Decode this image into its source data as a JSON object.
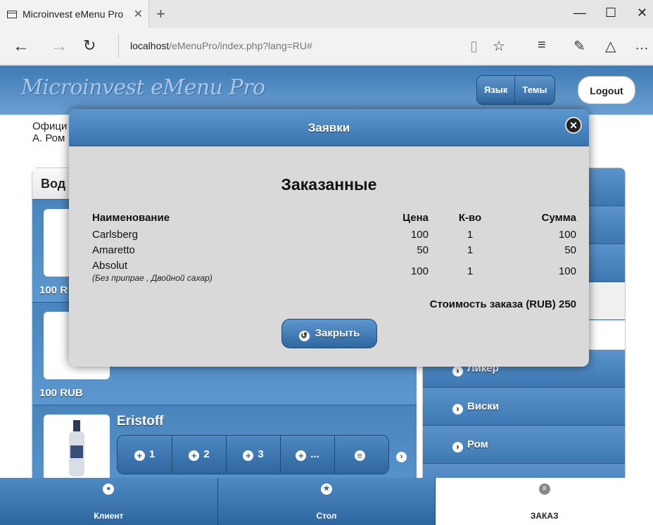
{
  "browser": {
    "tab_title": "Microinvest eMenu Pro",
    "url_host": "localhost",
    "url_rest": "/eMenuPro/index.php?lang=RU#"
  },
  "header": {
    "logo": "Microinvest eMenu Pro",
    "lang_button": "Язык",
    "themes_button": "Темы",
    "logout_button": "Logout"
  },
  "officer": {
    "line1": "Офици",
    "line2": "А. Ром"
  },
  "left_panel": {
    "title": "Вод",
    "products": [
      {
        "name": "",
        "price": "100 R"
      },
      {
        "name": "",
        "price": "100 RUB"
      },
      {
        "name": "Eristoff",
        "price": ""
      }
    ],
    "qty_buttons": [
      "1",
      "2",
      "3",
      "..."
    ]
  },
  "categories": [
    "Ликер",
    "Виски",
    "Ром"
  ],
  "bottom_nav": {
    "client": "Клиент",
    "table": "Стол",
    "order": "ЗАКАЗ"
  },
  "modal": {
    "title": "Заявки",
    "heading": "Заказанные",
    "columns": {
      "name": "Наименование",
      "price": "Цена",
      "qty": "К-во",
      "sum": "Сумма"
    },
    "rows": [
      {
        "name": "Carlsberg",
        "note": "",
        "price": "100",
        "qty": "1",
        "sum": "100"
      },
      {
        "name": "Amaretto",
        "note": "",
        "price": "50",
        "qty": "1",
        "sum": "50"
      },
      {
        "name": "Absolut",
        "note": "(Без припрае , Двойной сахар)",
        "price": "100",
        "qty": "1",
        "sum": "100"
      }
    ],
    "total_label": "Стоимость заказа (RUB) 250",
    "close_button": "Закрыть"
  }
}
